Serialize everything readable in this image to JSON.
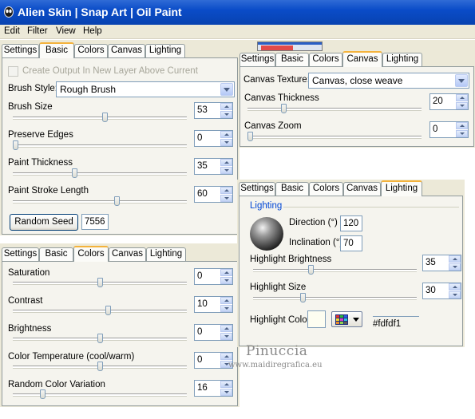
{
  "window": {
    "title": "Alien Skin | Snap Art | Oil Paint"
  },
  "menu": {
    "items": [
      "Edit",
      "Filter",
      "View",
      "Help"
    ]
  },
  "colors": {
    "titlebar": "#0a4cc8",
    "tab_highlight": "#f4b33c",
    "watermark_text": "#8a8a8a",
    "highlight_swatch": "#fdfdf1"
  },
  "basic_panel": {
    "tabs": [
      "Settings",
      "Basic",
      "Colors",
      "Canvas",
      "Lighting"
    ],
    "active_tab": "Basic",
    "create_output_label": "Create Output In New Layer Above Current",
    "create_output_checked": false,
    "brush_style_label": "Brush Style:",
    "brush_style_value": "Rough Brush",
    "sliders": [
      {
        "label": "Brush Size",
        "value": "53",
        "level": 0.53
      },
      {
        "label": "Preserve Edges",
        "value": "0",
        "level": 0.0
      },
      {
        "label": "Paint Thickness",
        "value": "35",
        "level": 0.35
      },
      {
        "label": "Paint Stroke Length",
        "value": "60",
        "level": 0.6
      }
    ],
    "random_seed_label": "Random Seed",
    "random_seed_value": "7556"
  },
  "colors_panel": {
    "tabs": [
      "Settings",
      "Basic",
      "Colors",
      "Canvas",
      "Lighting"
    ],
    "active_tab": "Colors",
    "sliders": [
      {
        "label": "Saturation",
        "value": "0",
        "level": 0.5
      },
      {
        "label": "Contrast",
        "value": "10",
        "level": 0.55
      },
      {
        "label": "Brightness",
        "value": "0",
        "level": 0.5
      },
      {
        "label": "Color Temperature (cool/warm)",
        "value": "0",
        "level": 0.5
      },
      {
        "label": "Random Color Variation",
        "value": "16",
        "level": 0.16
      }
    ]
  },
  "canvas_panel": {
    "tabs": [
      "Settings",
      "Basic",
      "Colors",
      "Canvas",
      "Lighting"
    ],
    "active_tab": "Canvas",
    "texture_label": "Canvas Texture:",
    "texture_value": "Canvas, close weave",
    "sliders": [
      {
        "label": "Canvas Thickness",
        "value": "20",
        "level": 0.2
      },
      {
        "label": "Canvas Zoom",
        "value": "0",
        "level": 0.0
      }
    ]
  },
  "lighting_panel": {
    "tabs": [
      "Settings",
      "Basic",
      "Colors",
      "Canvas",
      "Lighting"
    ],
    "active_tab": "Lighting",
    "group_label": "Lighting",
    "direction_label": "Direction (°)",
    "direction_value": "120",
    "inclination_label": "Inclination (°)",
    "inclination_value": "70",
    "sliders": [
      {
        "label": "Highlight Brightness",
        "value": "35",
        "level": 0.35
      },
      {
        "label": "Highlight Size",
        "value": "30",
        "level": 0.3
      }
    ],
    "highlight_color_label": "Highlight Color",
    "highlight_color_hex": "#fdfdf1"
  },
  "watermark": {
    "name": "Pinuccia",
    "url": "www.maidiregrafica.eu"
  }
}
